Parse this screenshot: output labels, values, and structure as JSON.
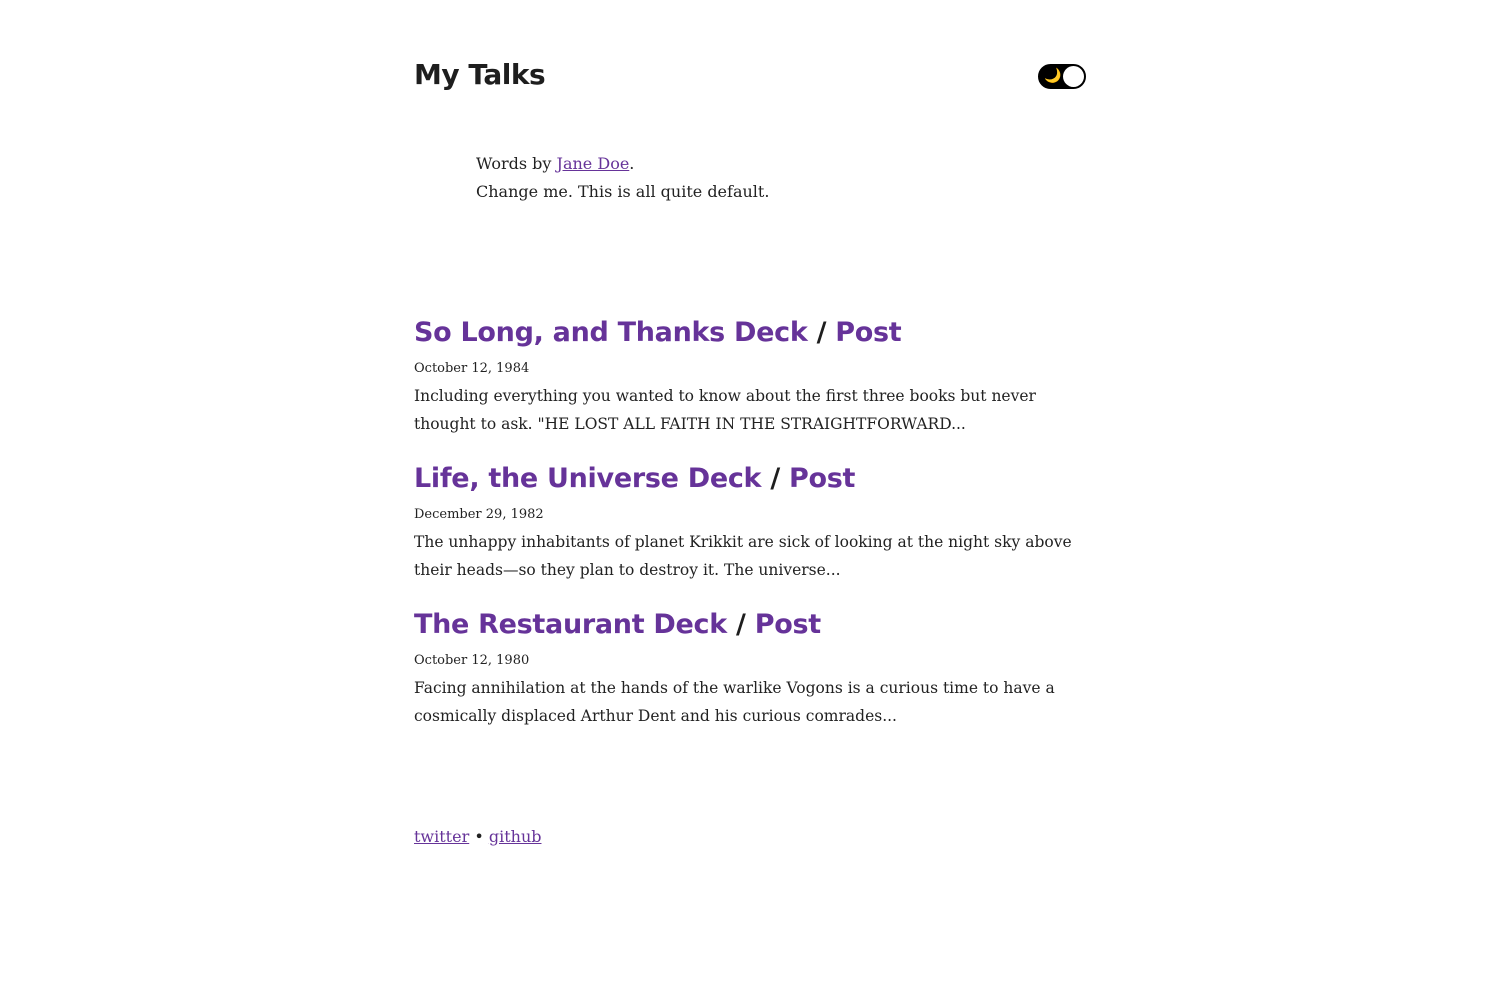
{
  "header": {
    "title": "My Talks",
    "theme_toggle": {
      "icon": "moon-icon",
      "glyph": "🌙"
    }
  },
  "bio": {
    "prefix": "Words by ",
    "author": "Jane Doe",
    "suffix": ".",
    "tagline": "Change me. This is all quite default."
  },
  "posts": [
    {
      "title": "So Long, and Thanks Deck",
      "separator": "/",
      "post_link": "Post",
      "date": "October 12, 1984",
      "description": "Including everything you wanted to know about the first three books but never thought to ask. \"HE LOST ALL FAITH IN THE STRAIGHTFORWARD..."
    },
    {
      "title": "Life, the Universe Deck",
      "separator": "/",
      "post_link": "Post",
      "date": "December 29, 1982",
      "description": "The unhappy inhabitants of planet Krikkit are sick of looking at the night sky above their heads—so they plan to destroy it. The universe..."
    },
    {
      "title": "The Restaurant Deck",
      "separator": "/",
      "post_link": "Post",
      "date": "October 12, 1980",
      "description": "Facing annihilation at the hands of the warlike Vogons is a curious time to have a cosmically displaced Arthur Dent and his curious comrades..."
    }
  ],
  "footer": {
    "twitter": "twitter",
    "separator": "•",
    "github": "github"
  },
  "colors": {
    "accent": "#663399",
    "text": "#222222",
    "background": "#ffffff"
  }
}
